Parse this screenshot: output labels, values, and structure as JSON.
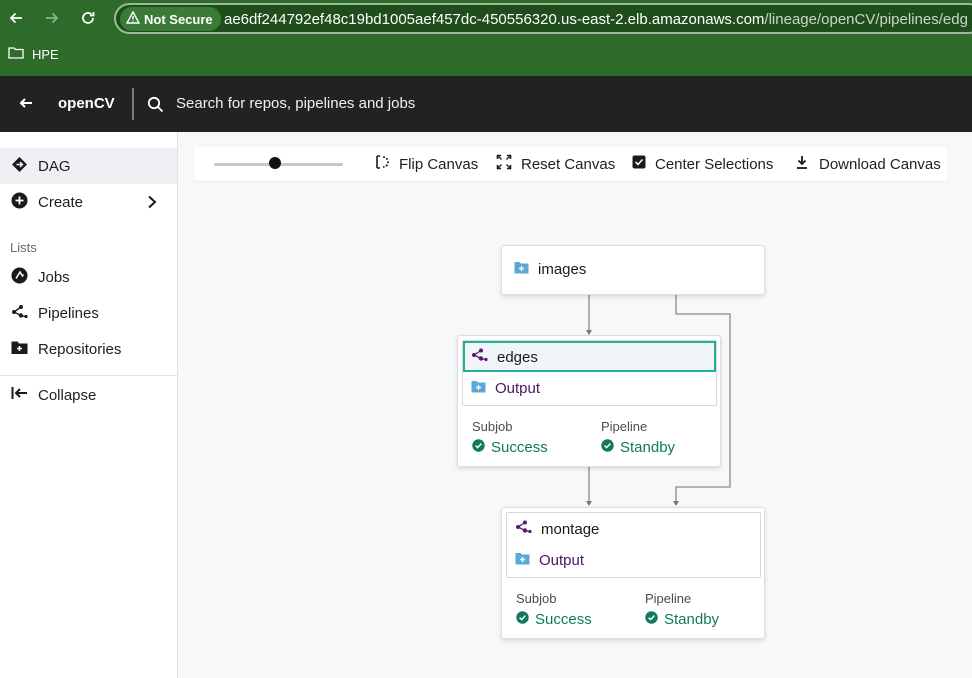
{
  "browser": {
    "security_label": "Not Secure",
    "url_host": "ae6df244792ef48c19bd1005aef457dc-450556320.us-east-2.elb.amazonaws.com",
    "url_path": "/lineage/openCV/pipelines/edg",
    "bookmark": "HPE"
  },
  "header": {
    "project": "openCV",
    "search_placeholder": "Search for repos, pipelines and jobs"
  },
  "sidebar": {
    "dag": "DAG",
    "create": "Create",
    "lists_title": "Lists",
    "jobs": "Jobs",
    "pipelines": "Pipelines",
    "repositories": "Repositories",
    "collapse": "Collapse"
  },
  "toolbar": {
    "zoom_level": 0.47,
    "flip": "Flip Canvas",
    "reset": "Reset Canvas",
    "center": "Center Selections",
    "download": "Download Canvas"
  },
  "dag": {
    "repo": {
      "name": "images"
    },
    "pipelines": [
      {
        "name": "edges",
        "output": "Output",
        "subjob_label": "Subjob",
        "subjob_status": "Success",
        "pipeline_label": "Pipeline",
        "pipeline_status": "Standby",
        "selected": true
      },
      {
        "name": "montage",
        "output": "Output",
        "subjob_label": "Subjob",
        "subjob_status": "Success",
        "pipeline_label": "Pipeline",
        "pipeline_status": "Standby",
        "selected": false
      }
    ]
  },
  "colors": {
    "browser_chrome": "#2e6a2a",
    "header": "#222222",
    "success": "#0f7a5e",
    "selected_border": "#21b09b",
    "repo_icon": "#5aa9d6",
    "pipeline_icon": "#5a1a73"
  }
}
